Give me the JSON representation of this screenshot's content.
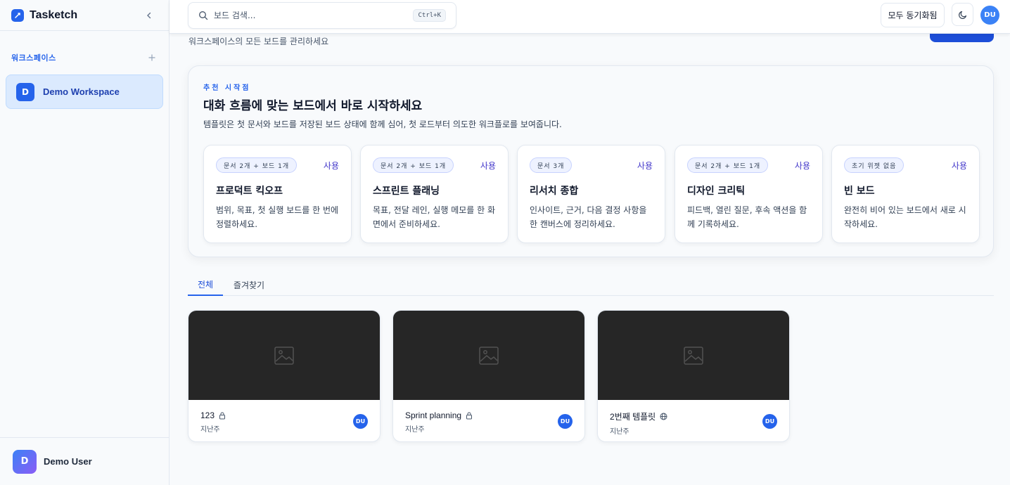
{
  "app": {
    "name": "Tasketch"
  },
  "sidebar": {
    "section_title": "워크스페이스",
    "workspaces": [
      {
        "initial": "D",
        "name": "Demo Workspace"
      }
    ],
    "user": {
      "initial": "D",
      "name": "Demo User"
    }
  },
  "topbar": {
    "search_placeholder": "보드 검색...",
    "shortcut": "Ctrl+K",
    "sync_label": "모두 동기화됨",
    "user_initials": "DU"
  },
  "page": {
    "subtitle": "워크스페이스의 모든 보드를 관리하세요"
  },
  "featured": {
    "eyebrow": "추천 시작점",
    "title": "대화 흐름에 맞는 보드에서 바로 시작하세요",
    "description": "템플릿은 첫 문서와 보드를 저장된 보드 상태에 함께 심어, 첫 로드부터 의도한 워크플로를 보여줍니다.",
    "templates": [
      {
        "badge": "문서 2개 + 보드 1개",
        "use_label": "사용",
        "title": "프로덕트 킥오프",
        "description": "범위, 목표, 첫 실행 보드를 한 번에 정렬하세요."
      },
      {
        "badge": "문서 2개 + 보드 1개",
        "use_label": "사용",
        "title": "스프린트 플래닝",
        "description": "목표, 전달 레인, 실행 메모를 한 화면에서 준비하세요."
      },
      {
        "badge": "문서 3개",
        "use_label": "사용",
        "title": "리서치 종합",
        "description": "인사이트, 근거, 다음 결정 사항을 한 캔버스에 정리하세요."
      },
      {
        "badge": "문서 2개 + 보드 1개",
        "use_label": "사용",
        "title": "디자인 크리틱",
        "description": "피드백, 열린 질문, 후속 액션을 함께 기록하세요."
      },
      {
        "badge": "초기 위젯 없음",
        "use_label": "사용",
        "title": "빈 보드",
        "description": "완전히 비어 있는 보드에서 새로 시작하세요."
      }
    ]
  },
  "tabs": [
    {
      "label": "전체",
      "active": true
    },
    {
      "label": "즐겨찾기",
      "active": false
    }
  ],
  "boards": [
    {
      "title": "123",
      "visibility_icon": "lock-icon",
      "time": "지난주",
      "owner_initials": "DU"
    },
    {
      "title": "Sprint planning",
      "visibility_icon": "lock-icon",
      "time": "지난주",
      "owner_initials": "DU"
    },
    {
      "title": "2번째 템플릿",
      "visibility_icon": "globe-icon",
      "time": "지난주",
      "owner_initials": "DU"
    }
  ],
  "colors": {
    "accent": "#2563eb",
    "thumbnail": "#262626",
    "workspace_active_bg": "#dbeafe"
  }
}
